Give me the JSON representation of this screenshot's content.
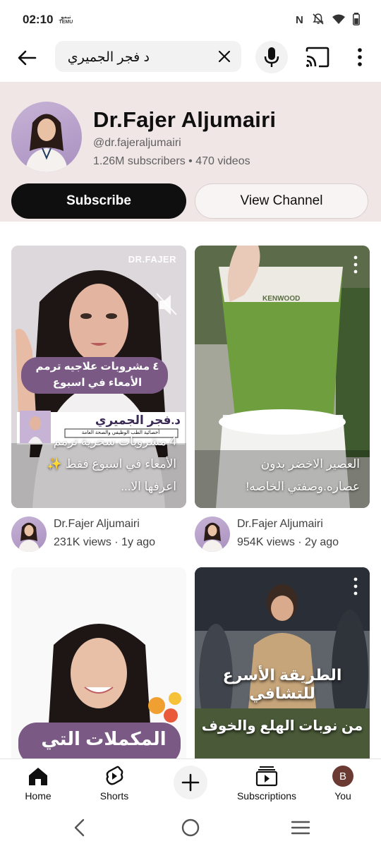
{
  "status_bar": {
    "time": "02:10",
    "temu_badge_line1": "ﺗﻴﻤﻮ",
    "temu_badge_line2": "TEMU"
  },
  "search": {
    "query": "د فجر الجميري"
  },
  "channel": {
    "name": "Dr.Fajer Aljumairi",
    "handle": "@dr.fajeraljumairi",
    "stats": "1.26M subscribers • 470 videos",
    "subscribe_label": "Subscribe",
    "view_label": "View Channel"
  },
  "shorts": [
    {
      "title": "4 مشروبات سحرية ترمم الأمعاء في اسبوع فقط ✨ اعرفها الا...",
      "channel": "Dr.Fajer Aljumairi",
      "stats": "231K views · 1y ago",
      "overlay_brand": "DR.FAJER",
      "overlay_quote": "٤ مشروبات علاجيه ترمم الأمعاء في اسبوع",
      "overlay_name": "د.فجر الجميري",
      "overlay_subtitle": "أخصائية الطب الوظيفي والصحة العامة"
    },
    {
      "title": "العصير الاخضر بدون عصاره.وصفتي الخاصه!",
      "channel": "Dr.Fajer Aljumairi",
      "stats": "954K views · 2y ago",
      "overlay_brand": "KENWOOD"
    },
    {
      "overlay_text": "المكملات التي"
    },
    {
      "overlay_line1": "الطريقة الأسرع للتشافي",
      "overlay_line2": "من نوبات الهلع والخوف"
    }
  ],
  "bottom_nav": {
    "home": "Home",
    "shorts": "Shorts",
    "subscriptions": "Subscriptions",
    "you": "You",
    "you_initial": "B"
  }
}
